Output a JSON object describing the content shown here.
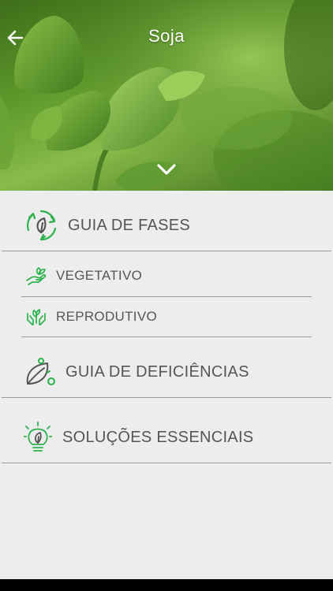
{
  "header": {
    "title": "Soja",
    "back_icon": "arrow-left-icon",
    "expand_icon": "chevron-down-icon"
  },
  "menu": {
    "phases": {
      "label": "GUIA DE FASES",
      "icon": "cycle-leaf-icon"
    },
    "vegetative": {
      "label": "VEGETATIVO",
      "icon": "hand-sprout-icon"
    },
    "reproductive": {
      "label": "REPRODUTIVO",
      "icon": "hands-plant-icon"
    },
    "deficiencies": {
      "label": "GUIA DE DEFICIÊNCIAS",
      "icon": "leaf-drop-icon"
    },
    "solutions": {
      "label": "SOLUÇÕES ESSENCIAIS",
      "icon": "bulb-leaf-icon"
    }
  },
  "colors": {
    "accent": "#2bb24c",
    "text": "#555555",
    "background": "#ededed",
    "divider": "#9a9a9a"
  }
}
